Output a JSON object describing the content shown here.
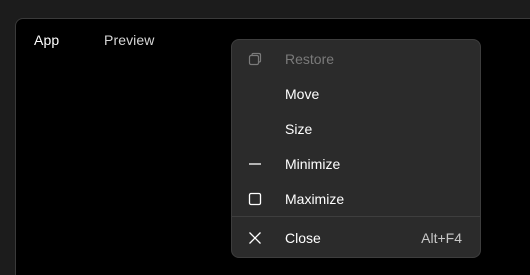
{
  "titlebar": {
    "tabs": [
      {
        "label": "App"
      },
      {
        "label": "Preview"
      }
    ]
  },
  "system_menu": {
    "items": [
      {
        "label": "Restore",
        "icon": "restore-icon",
        "enabled": false,
        "shortcut": ""
      },
      {
        "label": "Move",
        "icon": "",
        "enabled": true,
        "shortcut": ""
      },
      {
        "label": "Size",
        "icon": "",
        "enabled": true,
        "shortcut": ""
      },
      {
        "label": "Minimize",
        "icon": "minimize-icon",
        "enabled": true,
        "shortcut": ""
      },
      {
        "label": "Maximize",
        "icon": "maximize-icon",
        "enabled": true,
        "shortcut": ""
      },
      {
        "label": "Close",
        "icon": "close-icon",
        "enabled": true,
        "shortcut": "Alt+F4"
      }
    ]
  },
  "colors": {
    "window_bg": "#000000",
    "menu_bg": "#2b2b2b",
    "text": "#ffffff",
    "disabled_text": "#7a7a7a"
  }
}
